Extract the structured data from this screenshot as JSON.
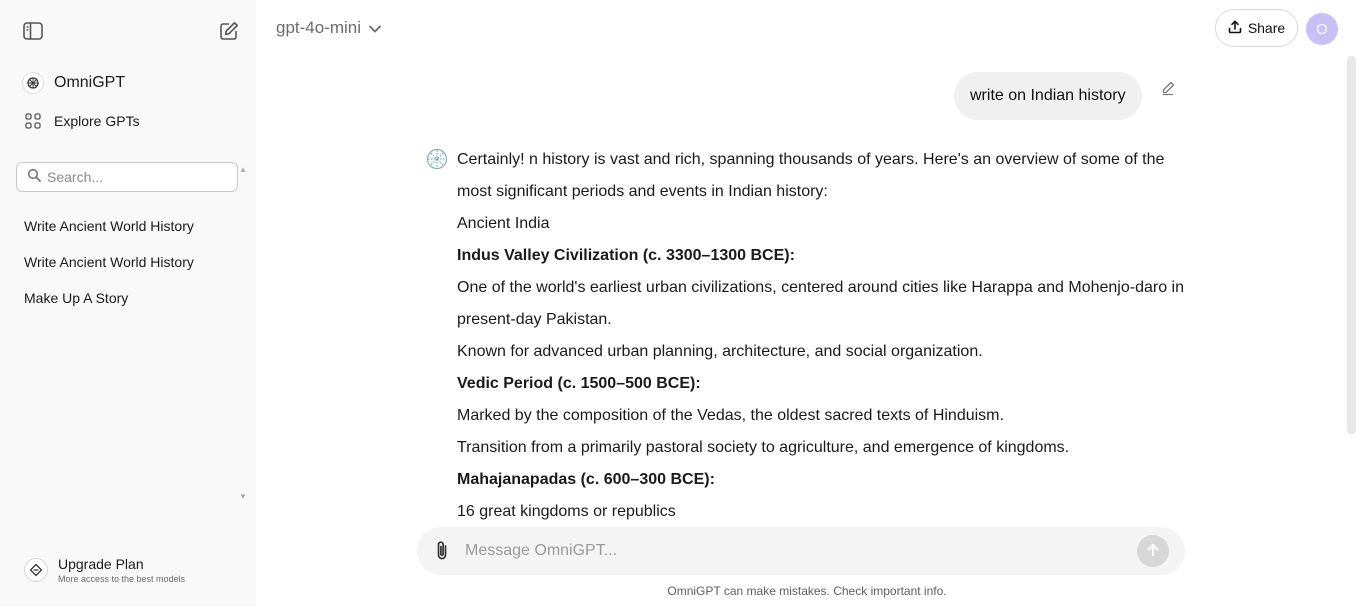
{
  "sidebar": {
    "brand": "OmniGPT",
    "explore": "Explore GPTs",
    "search_placeholder": "Search...",
    "history": [
      "Write Ancient World History",
      "Write Ancient World History",
      "Make Up A Story"
    ],
    "upgrade": {
      "title": "Upgrade Plan",
      "subtitle": "More access to the best models"
    }
  },
  "header": {
    "model": "gpt-4o-mini",
    "share": "Share",
    "avatar_initial": "O"
  },
  "chat": {
    "user_message": "write on Indian history",
    "answer": [
      {
        "text": "Certainly! n history is vast and rich, spanning thousands of years. Here's an overview of some of the most significant periods and events in Indian history:",
        "bold": false
      },
      {
        "text": "Ancient India",
        "bold": false
      },
      {
        "text": "Indus Valley Civilization (c. 3300–1300 BCE):",
        "bold": true
      },
      {
        "text": "One of the world's earliest urban civilizations, centered around cities like Harappa and Mohenjo-daro in present-day Pakistan.",
        "bold": false
      },
      {
        "text": "Known for advanced urban planning, architecture, and social organization.",
        "bold": false
      },
      {
        "text": "Vedic Period (c. 1500–500 BCE):",
        "bold": true
      },
      {
        "text": "Marked by the composition of the Vedas, the oldest sacred texts of Hinduism.",
        "bold": false
      },
      {
        "text": "Transition from a primarily pastoral society to agriculture, and emergence of kingdoms.",
        "bold": false
      },
      {
        "text": "Mahajanapadas (c. 600–300 BCE):",
        "bold": true
      },
      {
        "text": "16 great kingdoms or republics",
        "bold": false
      }
    ]
  },
  "composer": {
    "placeholder": "Message OmniGPT...",
    "disclaimer": "OmniGPT can make mistakes. Check important info."
  },
  "icons": {
    "sidebar_toggle": "sidebar-toggle-icon",
    "new_chat": "new-chat-icon",
    "brand": "omnigpt-logo-icon",
    "explore": "grid-icon",
    "search": "search-icon",
    "upgrade": "upgrade-icon",
    "chevron": "chevron-down-icon",
    "share": "upload-icon",
    "edit": "pencil-icon",
    "attach": "paperclip-icon",
    "send": "arrow-up-icon"
  },
  "colors": {
    "sidebar_bg": "#f9f9f9",
    "avatar_bg": "#c7bff5",
    "composer_bg": "#f4f4f4",
    "user_bubble_bg": "#f0f0f0"
  }
}
